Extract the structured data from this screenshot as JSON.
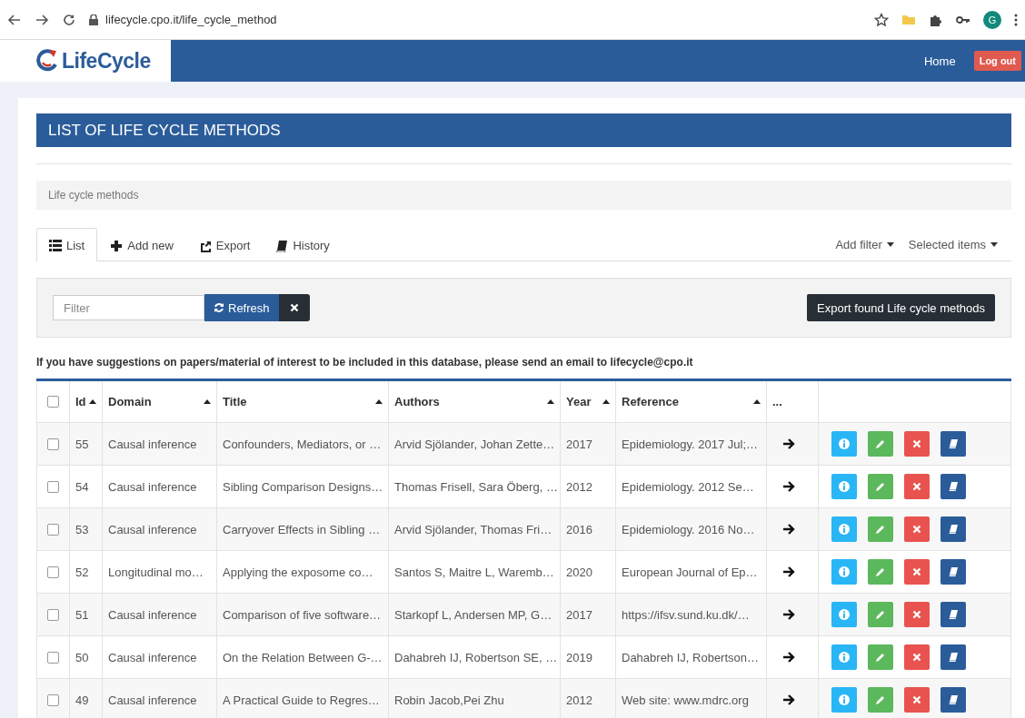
{
  "browser": {
    "url": "lifecycle.cpo.it/life_cycle_method",
    "profile_initial": "G"
  },
  "navbar": {
    "logo": "LifeCycle",
    "links": [
      {
        "label": "Home",
        "kind": "link"
      },
      {
        "label": "Log out",
        "kind": "button"
      }
    ]
  },
  "page_title": "LIST OF LIFE CYCLE METHODS",
  "breadcrumb": "Life cycle methods",
  "tabs": [
    {
      "label": "List",
      "selected": true
    },
    {
      "label": "Add new",
      "selected": false
    },
    {
      "label": "Export",
      "selected": false
    },
    {
      "label": "History",
      "selected": false
    }
  ],
  "menus": [
    {
      "label": "Add filter"
    },
    {
      "label": "Selected items"
    }
  ],
  "filter": {
    "placeholder": "Filter",
    "refresh": "Refresh",
    "export": "Export found Life cycle methods"
  },
  "notice": "If you have suggestions on papers/material of interest to be included in this database, please send an email to lifecycle@cpo.it",
  "table": {
    "select_all": {
      "checked": false
    },
    "columns": [
      {
        "label": "Id",
        "sortable": true
      },
      {
        "label": "Domain",
        "sortable": true
      },
      {
        "label": "Title",
        "sortable": true
      },
      {
        "label": "Authors",
        "sortable": true
      },
      {
        "label": "Year",
        "sortable": true
      },
      {
        "label": "Reference",
        "sortable": true
      },
      {
        "label": "...",
        "sortable": false
      }
    ],
    "rows": [
      {
        "checked": false,
        "id": "55",
        "domain": "Causal inference",
        "title": "Confounders, Mediators, or …",
        "authors": "Arvid Sjölander, Johan Zette…",
        "year": "2017",
        "reference": "Epidemiology. 2017 Jul;…"
      },
      {
        "checked": false,
        "id": "54",
        "domain": "Causal inference",
        "title": "Sibling Comparison Designs…",
        "authors": "Thomas Frisell, Sara Öberg, …",
        "year": "2012",
        "reference": "Epidemiology. 2012 Se…"
      },
      {
        "checked": false,
        "id": "53",
        "domain": "Causal inference",
        "title": "Carryover Effects in Sibling …",
        "authors": "Arvid Sjölander, Thomas Fri…",
        "year": "2016",
        "reference": "Epidemiology. 2016 No…"
      },
      {
        "checked": false,
        "id": "52",
        "domain": "Longitudinal mo…",
        "title": "Applying the exposome co…",
        "authors": "Santos S, Maitre L, Waremb…",
        "year": "2020",
        "reference": "European Journal of Ep…"
      },
      {
        "checked": false,
        "id": "51",
        "domain": "Causal inference",
        "title": "Comparison of five software…",
        "authors": "Starkopf L, Andersen MP, G…",
        "year": "2017",
        "reference": "https://ifsv.sund.ku.dk/…"
      },
      {
        "checked": false,
        "id": "50",
        "domain": "Causal inference",
        "title": "On the Relation Between G-…",
        "authors": "Dahabreh IJ, Robertson SE, …",
        "year": "2019",
        "reference": "Dahabreh IJ, Robertson…"
      },
      {
        "checked": false,
        "id": "49",
        "domain": "Causal inference",
        "title": "A Practical Guide to Regres…",
        "authors": "Robin Jacob,Pei Zhu",
        "year": "2012",
        "reference": "Web site: www.mdrc.org"
      }
    ]
  }
}
